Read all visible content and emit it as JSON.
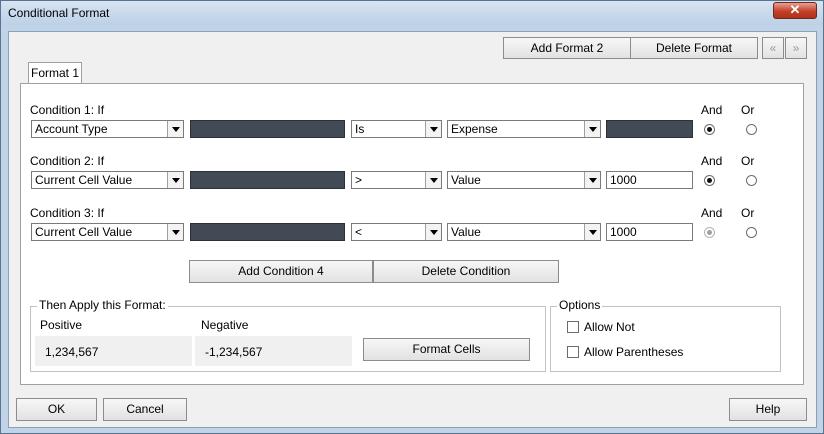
{
  "window": {
    "title": "Conditional Format",
    "close_label": "✕"
  },
  "toolbar": {
    "add_format_label": "Add Format 2",
    "delete_format_label": "Delete Format",
    "prev_icon": "«",
    "next_icon": "»"
  },
  "tabs": [
    {
      "label": "Format 1"
    }
  ],
  "conditions": [
    {
      "label": "Condition 1: If",
      "field": "Account Type",
      "operator": "Is",
      "value_type": "Expense",
      "value": "",
      "and_label": "And",
      "or_label": "Or",
      "and_selected": true,
      "enabled": true
    },
    {
      "label": "Condition 2: If",
      "field": "Current Cell Value",
      "operator": ">",
      "value_type": "Value",
      "value": "1000",
      "and_label": "And",
      "or_label": "Or",
      "and_selected": true,
      "enabled": true
    },
    {
      "label": "Condition 3: If",
      "field": "Current Cell Value",
      "operator": "<",
      "value_type": "Value",
      "value": "1000",
      "and_label": "And",
      "or_label": "Or",
      "and_selected": true,
      "enabled": false
    }
  ],
  "condition_buttons": {
    "add_label": "Add Condition 4",
    "delete_label": "Delete Condition"
  },
  "apply_format": {
    "title": "Then Apply this Format:",
    "positive_label": "Positive",
    "negative_label": "Negative",
    "positive_value": "1,234,567",
    "negative_value": "-1,234,567",
    "format_cells_label": "Format Cells"
  },
  "options": {
    "title": "Options",
    "allow_not_label": "Allow Not",
    "allow_parentheses_label": "Allow Parentheses"
  },
  "footer": {
    "ok_label": "OK",
    "cancel_label": "Cancel",
    "help_label": "Help"
  },
  "colors": {
    "window_frame": "#c0d3e7",
    "dark_field": "#414a55",
    "close_red": "#c2402a"
  }
}
